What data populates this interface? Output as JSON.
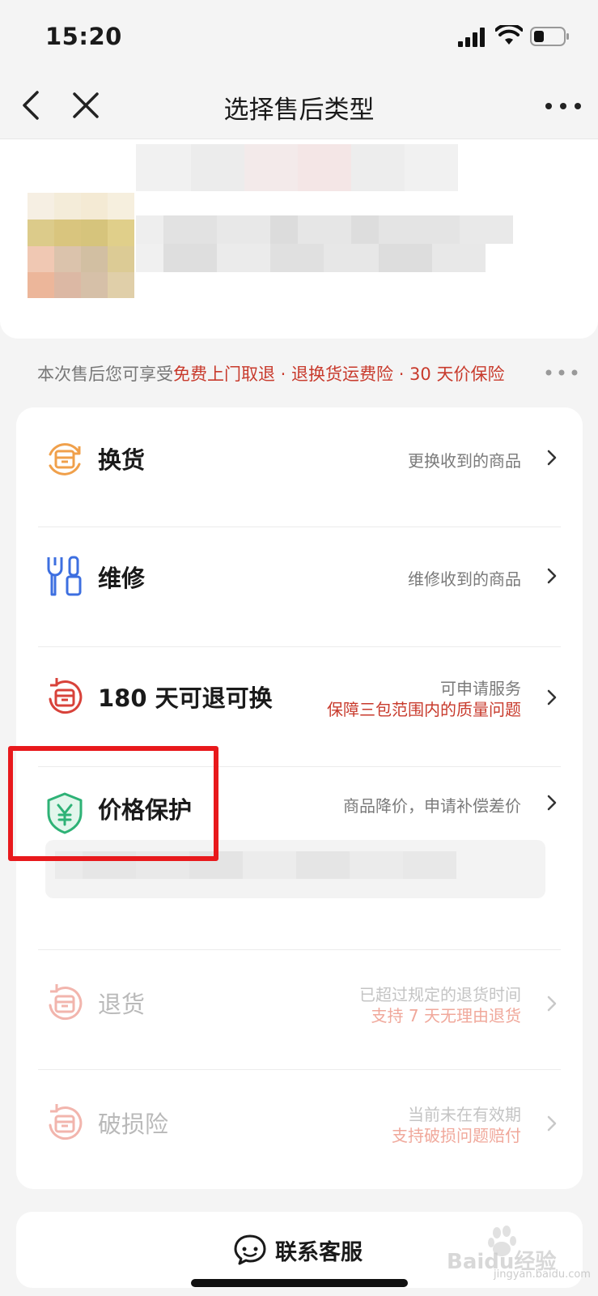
{
  "status_bar": {
    "time": "15:20"
  },
  "nav": {
    "title": "选择售后类型"
  },
  "benefits": {
    "prefix": "本次售后您可享受",
    "highlight": "免费上门取退 · 退换货运费险 · 30 天价保险"
  },
  "options": [
    {
      "id": "exchange",
      "title": "换货",
      "desc": "更换收到的商品",
      "desc_red": "",
      "icon": "exchange-box-icon",
      "icon_color": "#f0a04b",
      "enabled": true
    },
    {
      "id": "repair",
      "title": "维修",
      "desc": "维修收到的商品",
      "desc_red": "",
      "icon": "wrench-screwdriver-icon",
      "icon_color": "#3d6fe0",
      "enabled": true
    },
    {
      "id": "return180",
      "title": "180 天可退可换",
      "desc": "可申请服务",
      "desc_red": "保障三包范围内的质量问题",
      "icon": "return-box-icon",
      "icon_color": "#d8423a",
      "enabled": true
    },
    {
      "id": "price_protect",
      "title": "价格保护",
      "desc": "商品降价，申请补偿差价",
      "desc_red": "",
      "icon": "yen-shield-icon",
      "icon_color": "#2eb276",
      "enabled": true
    },
    {
      "id": "refund",
      "title": "退货",
      "desc": "已超过规定的退货时间",
      "desc_red": "支持 7 天无理由退货",
      "icon": "return-box-icon",
      "icon_color": "#f2b5ad",
      "enabled": false
    },
    {
      "id": "damage_ins",
      "title": "破损险",
      "desc": "当前未在有效期",
      "desc_red": "支持破损问题赔付",
      "icon": "return-box-icon",
      "icon_color": "#f2b5ad",
      "enabled": false
    }
  ],
  "bottom": {
    "contact_label": "联系客服"
  },
  "watermark": {
    "brand": "Baidu经验",
    "url": "jingyan.baidu.com"
  },
  "colors": {
    "accent_red": "#c83a2c",
    "annotation_red": "#e8191c",
    "background": "#f4f4f4"
  }
}
